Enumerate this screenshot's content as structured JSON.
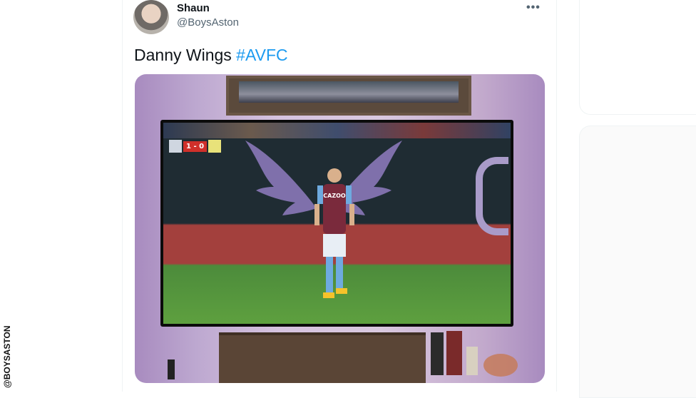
{
  "tweet": {
    "display_name": "Shaun",
    "handle": "@BoysAston",
    "text_main": "Danny Wings ",
    "hashtag": "#AVFC",
    "more_icon": "more-horizontal-icon"
  },
  "broadcast": {
    "score": "1 - 0",
    "sponsor": "CAZOO"
  },
  "watermark": "@BOYSASTON"
}
